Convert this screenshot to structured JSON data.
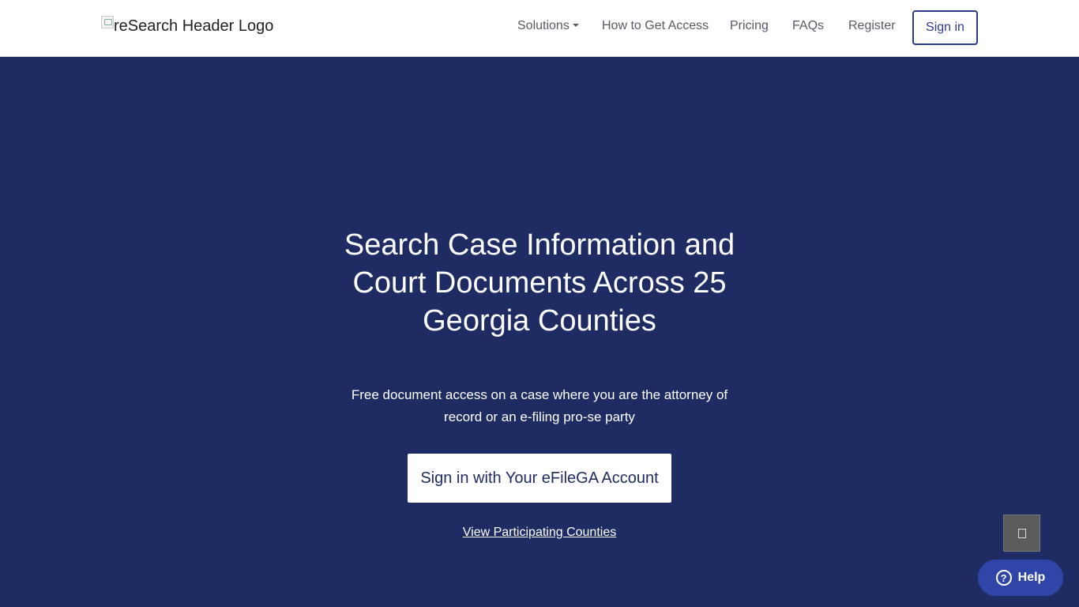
{
  "header": {
    "logo_alt": "reSearch Header Logo",
    "nav": {
      "solutions": "Solutions",
      "how_to_get_access": "How to Get Access",
      "pricing": "Pricing",
      "faqs": "FAQs",
      "register": "Register",
      "sign_in": "Sign in"
    }
  },
  "hero": {
    "title": "Search Case Information and Court Documents Across 25 Georgia Counties",
    "subtitle": "Free document access on a case where you are the attorney of record or an e-filing pro-se party",
    "cta_label": "Sign in with Your eFileGA Account",
    "counties_link": "View Participating Counties"
  },
  "widgets": {
    "help_label": "Help",
    "help_icon_glyph": "?",
    "scroll_icon": "square-icon"
  },
  "colors": {
    "hero_bg": "#1f2c63",
    "accent": "#2b3a8c",
    "help_bg": "#2f46a8"
  }
}
